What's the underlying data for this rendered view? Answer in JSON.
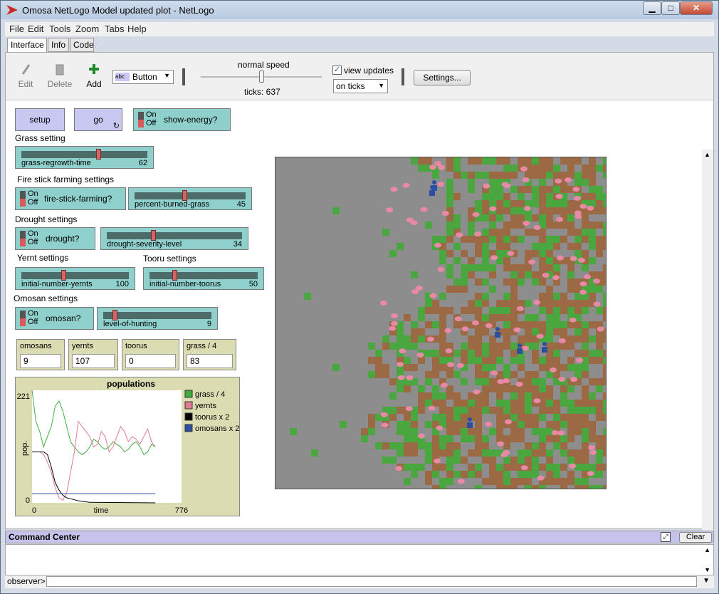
{
  "window": {
    "title": "Omosa NetLogo Model updated plot - NetLogo"
  },
  "menu": [
    "File",
    "Edit",
    "Tools",
    "Zoom",
    "Tabs",
    "Help"
  ],
  "tabs": [
    "Interface",
    "Info",
    "Code"
  ],
  "toolbar": {
    "edit": "Edit",
    "delete": "Delete",
    "add": "Add",
    "widget_type": "Button",
    "speed_label": "normal speed",
    "ticks_label": "ticks: 637",
    "view_updates": "view updates",
    "view_updates_checked": true,
    "update_mode": "on ticks",
    "settings": "Settings..."
  },
  "interface": {
    "setup": "setup",
    "go": "go",
    "switch_on": "On",
    "switch_off": "Off",
    "show_energy": "show-energy?",
    "grass_setting": "Grass setting",
    "grass_regrowth": {
      "name": "grass-regrowth-time",
      "value": "62",
      "frac": 0.62
    },
    "fire_settings": "Fire stick farming settings",
    "fire_switch": "fire-stick-farming?",
    "percent_burned": {
      "name": "percent-burned-grass",
      "value": "45",
      "frac": 0.45
    },
    "drought_settings": "Drought settings",
    "drought_switch": "drought?",
    "drought_severity": {
      "name": "drought-severity-level",
      "value": "34",
      "frac": 0.34
    },
    "yernt_settings": "Yernt settings",
    "tooru_settings": "Tooru settings",
    "init_yernts": {
      "name": "initial-number-yernts",
      "value": "100",
      "frac": 0.39
    },
    "init_toorus": {
      "name": "initial-number-toorus",
      "value": "50",
      "frac": 0.22
    },
    "omosan_settings": "Omosan settings",
    "omosan_switch": "omosan?",
    "hunting": {
      "name": "level-of-hunting",
      "value": "9",
      "frac": 0.09
    },
    "monitors": [
      {
        "name": "omosans",
        "value": "9"
      },
      {
        "name": "yernts",
        "value": "107"
      },
      {
        "name": "toorus",
        "value": "0"
      },
      {
        "name": "grass / 4",
        "value": "83"
      }
    ]
  },
  "chart_data": {
    "type": "line",
    "title": "populations",
    "xlabel": "time",
    "ylabel": "pop.",
    "xlim": [
      0,
      776
    ],
    "ylim": [
      0,
      221
    ],
    "x_tick_labels": [
      "0",
      "776"
    ],
    "y_tick_labels": [
      "0",
      "221"
    ],
    "series": [
      {
        "name": "grass / 4",
        "color": "#3fae3f",
        "x": [
          0,
          20,
          40,
          60,
          80,
          100,
          120,
          140,
          160,
          180,
          200,
          220,
          240,
          260,
          280,
          300,
          320,
          340,
          360,
          380,
          400,
          420,
          440,
          460,
          480,
          500,
          520,
          540,
          560,
          580,
          600,
          620,
          640
        ],
        "values": [
          221,
          160,
          140,
          110,
          130,
          150,
          190,
          200,
          180,
          150,
          120,
          110,
          100,
          95,
          100,
          110,
          125,
          120,
          110,
          105,
          110,
          120,
          115,
          110,
          100,
          105,
          115,
          120,
          110,
          95,
          100,
          115,
          110
        ]
      },
      {
        "name": "yernts",
        "color": "#e07b93",
        "x": [
          0,
          20,
          40,
          60,
          80,
          100,
          120,
          140,
          160,
          180,
          200,
          220,
          240,
          260,
          280,
          300,
          320,
          340,
          360,
          380,
          400,
          420,
          440,
          460,
          480,
          500,
          520,
          540,
          560,
          580,
          600,
          620,
          640
        ],
        "values": [
          100,
          100,
          100,
          95,
          80,
          60,
          30,
          10,
          5,
          20,
          60,
          100,
          160,
          150,
          140,
          130,
          110,
          115,
          140,
          130,
          100,
          110,
          130,
          150,
          140,
          120,
          130,
          125,
          115,
          130,
          145,
          120,
          110
        ]
      },
      {
        "name": "toorus x 2",
        "color": "#000000",
        "x": [
          0,
          20,
          40,
          60,
          80,
          100,
          120,
          140,
          160,
          180,
          200,
          220,
          240,
          260,
          280,
          300,
          640
        ],
        "values": [
          100,
          100,
          100,
          100,
          95,
          70,
          40,
          25,
          15,
          10,
          8,
          6,
          4,
          3,
          2,
          1,
          0
        ]
      },
      {
        "name": "omosans x 2",
        "color": "#2c4fa3",
        "x": [
          0,
          640
        ],
        "values": [
          18,
          18
        ]
      }
    ]
  },
  "command_center": {
    "title": "Command Center",
    "clear": "Clear",
    "observer": "observer>"
  }
}
